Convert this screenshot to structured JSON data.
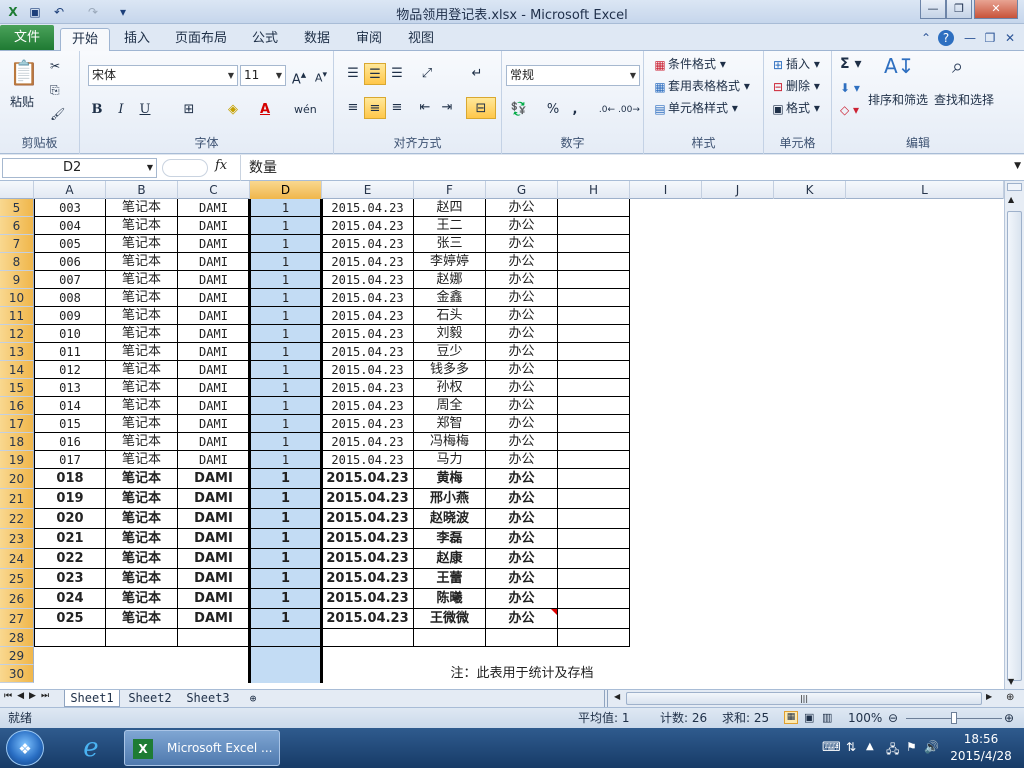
{
  "window": {
    "title": "物品领用登记表.xlsx - Microsoft Excel"
  },
  "ribbon_tabs": {
    "file": "文件",
    "home": "开始",
    "insert": "插入",
    "layout": "页面布局",
    "formulas": "公式",
    "data": "数据",
    "review": "审阅",
    "view": "视图"
  },
  "clipboard": {
    "paste": "粘贴",
    "group": "剪贴板"
  },
  "font": {
    "name": "宋体",
    "size": "11",
    "group": "字体",
    "bold": "B",
    "italic": "I",
    "underline": "U"
  },
  "alignment": {
    "group": "对齐方式"
  },
  "number": {
    "format": "常规",
    "group": "数字",
    "percent": "%",
    "comma": ","
  },
  "styles": {
    "conditional": "条件格式",
    "table": "套用表格格式",
    "cell": "单元格样式",
    "group": "样式"
  },
  "cells": {
    "insert": "插入",
    "delete": "删除",
    "format": "格式",
    "group": "单元格"
  },
  "editing": {
    "sum": "Σ",
    "sort": "排序和筛选",
    "find": "查找和选择",
    "group": "编辑"
  },
  "formula_bar": {
    "name_box": "D2",
    "fx": "fx",
    "content": "数量"
  },
  "columns": [
    "A",
    "B",
    "C",
    "D",
    "E",
    "F",
    "G",
    "H",
    "I",
    "J",
    "K",
    "L"
  ],
  "rows_plain": [
    {
      "n": "5",
      "a": "003",
      "b": "笔记本",
      "c": "DAMI",
      "d": "1",
      "e": "2015.04.23",
      "f": "赵四",
      "g": "办公"
    },
    {
      "n": "6",
      "a": "004",
      "b": "笔记本",
      "c": "DAMI",
      "d": "1",
      "e": "2015.04.23",
      "f": "王二",
      "g": "办公"
    },
    {
      "n": "7",
      "a": "005",
      "b": "笔记本",
      "c": "DAMI",
      "d": "1",
      "e": "2015.04.23",
      "f": "张三",
      "g": "办公"
    },
    {
      "n": "8",
      "a": "006",
      "b": "笔记本",
      "c": "DAMI",
      "d": "1",
      "e": "2015.04.23",
      "f": "李婷婷",
      "g": "办公"
    },
    {
      "n": "9",
      "a": "007",
      "b": "笔记本",
      "c": "DAMI",
      "d": "1",
      "e": "2015.04.23",
      "f": "赵娜",
      "g": "办公"
    },
    {
      "n": "10",
      "a": "008",
      "b": "笔记本",
      "c": "DAMI",
      "d": "1",
      "e": "2015.04.23",
      "f": "金鑫",
      "g": "办公"
    },
    {
      "n": "11",
      "a": "009",
      "b": "笔记本",
      "c": "DAMI",
      "d": "1",
      "e": "2015.04.23",
      "f": "石头",
      "g": "办公"
    },
    {
      "n": "12",
      "a": "010",
      "b": "笔记本",
      "c": "DAMI",
      "d": "1",
      "e": "2015.04.23",
      "f": "刘毅",
      "g": "办公"
    },
    {
      "n": "13",
      "a": "011",
      "b": "笔记本",
      "c": "DAMI",
      "d": "1",
      "e": "2015.04.23",
      "f": "豆少",
      "g": "办公"
    },
    {
      "n": "14",
      "a": "012",
      "b": "笔记本",
      "c": "DAMI",
      "d": "1",
      "e": "2015.04.23",
      "f": "钱多多",
      "g": "办公"
    },
    {
      "n": "15",
      "a": "013",
      "b": "笔记本",
      "c": "DAMI",
      "d": "1",
      "e": "2015.04.23",
      "f": "孙权",
      "g": "办公"
    },
    {
      "n": "16",
      "a": "014",
      "b": "笔记本",
      "c": "DAMI",
      "d": "1",
      "e": "2015.04.23",
      "f": "周全",
      "g": "办公"
    },
    {
      "n": "17",
      "a": "015",
      "b": "笔记本",
      "c": "DAMI",
      "d": "1",
      "e": "2015.04.23",
      "f": "郑智",
      "g": "办公"
    },
    {
      "n": "18",
      "a": "016",
      "b": "笔记本",
      "c": "DAMI",
      "d": "1",
      "e": "2015.04.23",
      "f": "冯梅梅",
      "g": "办公"
    },
    {
      "n": "19",
      "a": "017",
      "b": "笔记本",
      "c": "DAMI",
      "d": "1",
      "e": "2015.04.23",
      "f": "马力",
      "g": "办公"
    }
  ],
  "rows_bold": [
    {
      "n": "20",
      "a": "018",
      "b": "笔记本",
      "c": "DAMI",
      "d": "1",
      "e": "2015.04.23",
      "f": "黄梅",
      "g": "办公"
    },
    {
      "n": "21",
      "a": "019",
      "b": "笔记本",
      "c": "DAMI",
      "d": "1",
      "e": "2015.04.23",
      "f": "邢小燕",
      "g": "办公"
    },
    {
      "n": "22",
      "a": "020",
      "b": "笔记本",
      "c": "DAMI",
      "d": "1",
      "e": "2015.04.23",
      "f": "赵晓波",
      "g": "办公"
    },
    {
      "n": "23",
      "a": "021",
      "b": "笔记本",
      "c": "DAMI",
      "d": "1",
      "e": "2015.04.23",
      "f": "李磊",
      "g": "办公"
    },
    {
      "n": "24",
      "a": "022",
      "b": "笔记本",
      "c": "DAMI",
      "d": "1",
      "e": "2015.04.23",
      "f": "赵康",
      "g": "办公"
    },
    {
      "n": "25",
      "a": "023",
      "b": "笔记本",
      "c": "DAMI",
      "d": "1",
      "e": "2015.04.23",
      "f": "王蕾",
      "g": "办公"
    },
    {
      "n": "26",
      "a": "024",
      "b": "笔记本",
      "c": "DAMI",
      "d": "1",
      "e": "2015.04.23",
      "f": "陈曦",
      "g": "办公"
    },
    {
      "n": "27",
      "a": "025",
      "b": "笔记本",
      "c": "DAMI",
      "d": "1",
      "e": "2015.04.23",
      "f": "王微微",
      "g": "办公"
    }
  ],
  "rows_empty": [
    "28",
    "29",
    "30"
  ],
  "note": "注：此表用于统计及存档",
  "sheets": [
    "Sheet1",
    "Sheet2",
    "Sheet3"
  ],
  "status": {
    "ready": "就绪",
    "average": "平均值: 1",
    "count": "计数: 26",
    "sum": "求和: 25",
    "zoom": "100%"
  },
  "taskbar": {
    "app": "Microsoft Excel ...",
    "time": "18:56",
    "date": "2015/4/28"
  },
  "colors": {
    "selection": "#c3dcf4",
    "header_selected": "#f0b64b",
    "accent": "#1f7a33"
  }
}
